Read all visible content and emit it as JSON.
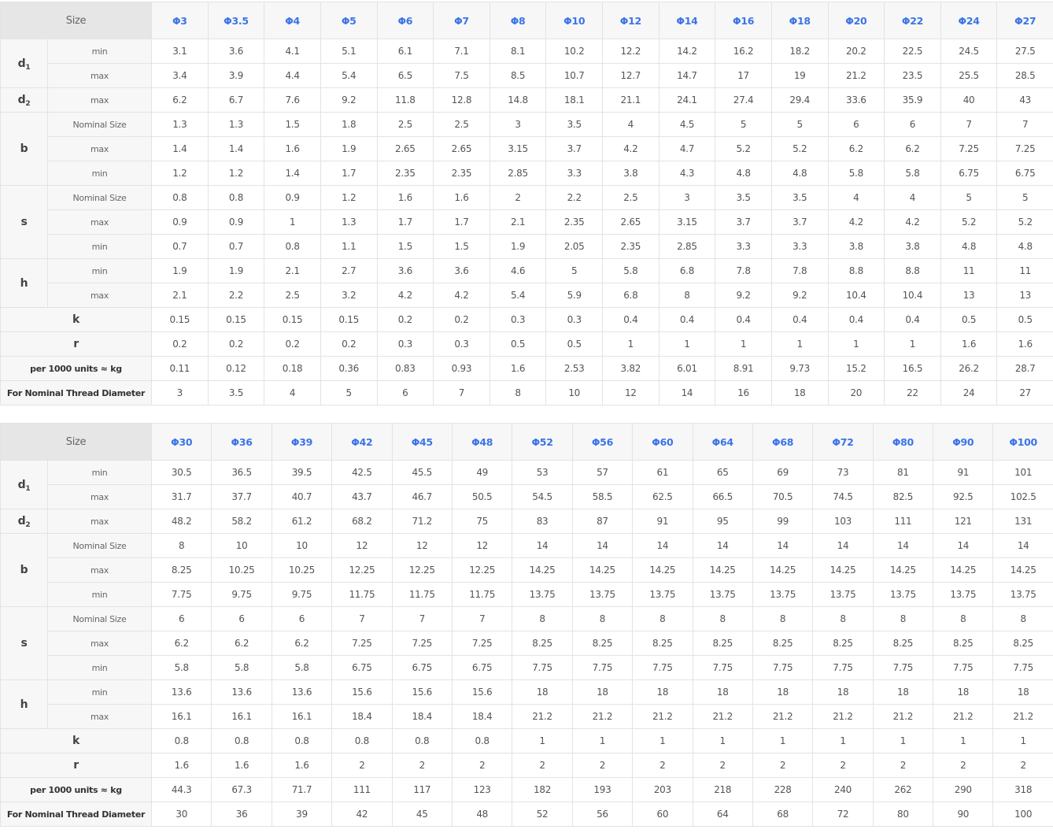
{
  "labels": {
    "size": "Size",
    "d1": "d",
    "d1_sub": "1",
    "d2": "d",
    "d2_sub": "2",
    "b": "b",
    "s": "s",
    "h": "h",
    "k": "k",
    "r": "r",
    "min": "min",
    "max": "max",
    "nominal": "Nominal Size",
    "weight": "per 1000 units ≈ kg",
    "thread": "For Nominal Thread Diameter"
  },
  "tables": [
    {
      "sizes": [
        "Φ3",
        "Φ3.5",
        "Φ4",
        "Φ5",
        "Φ6",
        "Φ7",
        "Φ8",
        "Φ10",
        "Φ12",
        "Φ14",
        "Φ16",
        "Φ18",
        "Φ20",
        "Φ22",
        "Φ24",
        "Φ27"
      ],
      "rows": {
        "d1_min": [
          "3.1",
          "3.6",
          "4.1",
          "5.1",
          "6.1",
          "7.1",
          "8.1",
          "10.2",
          "12.2",
          "14.2",
          "16.2",
          "18.2",
          "20.2",
          "22.5",
          "24.5",
          "27.5"
        ],
        "d1_max": [
          "3.4",
          "3.9",
          "4.4",
          "5.4",
          "6.5",
          "7.5",
          "8.5",
          "10.7",
          "12.7",
          "14.7",
          "17",
          "19",
          "21.2",
          "23.5",
          "25.5",
          "28.5"
        ],
        "d2_max": [
          "6.2",
          "6.7",
          "7.6",
          "9.2",
          "11.8",
          "12.8",
          "14.8",
          "18.1",
          "21.1",
          "24.1",
          "27.4",
          "29.4",
          "33.6",
          "35.9",
          "40",
          "43"
        ],
        "b_nom": [
          "1.3",
          "1.3",
          "1.5",
          "1.8",
          "2.5",
          "2.5",
          "3",
          "3.5",
          "4",
          "4.5",
          "5",
          "5",
          "6",
          "6",
          "7",
          "7"
        ],
        "b_max": [
          "1.4",
          "1.4",
          "1.6",
          "1.9",
          "2.65",
          "2.65",
          "3.15",
          "3.7",
          "4.2",
          "4.7",
          "5.2",
          "5.2",
          "6.2",
          "6.2",
          "7.25",
          "7.25"
        ],
        "b_min": [
          "1.2",
          "1.2",
          "1.4",
          "1.7",
          "2.35",
          "2.35",
          "2.85",
          "3.3",
          "3.8",
          "4.3",
          "4.8",
          "4.8",
          "5.8",
          "5.8",
          "6.75",
          "6.75"
        ],
        "s_nom": [
          "0.8",
          "0.8",
          "0.9",
          "1.2",
          "1.6",
          "1.6",
          "2",
          "2.2",
          "2.5",
          "3",
          "3.5",
          "3.5",
          "4",
          "4",
          "5",
          "5"
        ],
        "s_max": [
          "0.9",
          "0.9",
          "1",
          "1.3",
          "1.7",
          "1.7",
          "2.1",
          "2.35",
          "2.65",
          "3.15",
          "3.7",
          "3.7",
          "4.2",
          "4.2",
          "5.2",
          "5.2"
        ],
        "s_min": [
          "0.7",
          "0.7",
          "0.8",
          "1.1",
          "1.5",
          "1.5",
          "1.9",
          "2.05",
          "2.35",
          "2.85",
          "3.3",
          "3.3",
          "3.8",
          "3.8",
          "4.8",
          "4.8"
        ],
        "h_min": [
          "1.9",
          "1.9",
          "2.1",
          "2.7",
          "3.6",
          "3.6",
          "4.6",
          "5",
          "5.8",
          "6.8",
          "7.8",
          "7.8",
          "8.8",
          "8.8",
          "11",
          "11"
        ],
        "h_max": [
          "2.1",
          "2.2",
          "2.5",
          "3.2",
          "4.2",
          "4.2",
          "5.4",
          "5.9",
          "6.8",
          "8",
          "9.2",
          "9.2",
          "10.4",
          "10.4",
          "13",
          "13"
        ],
        "k": [
          "0.15",
          "0.15",
          "0.15",
          "0.15",
          "0.2",
          "0.2",
          "0.3",
          "0.3",
          "0.4",
          "0.4",
          "0.4",
          "0.4",
          "0.4",
          "0.4",
          "0.5",
          "0.5"
        ],
        "r": [
          "0.2",
          "0.2",
          "0.2",
          "0.2",
          "0.3",
          "0.3",
          "0.5",
          "0.5",
          "1",
          "1",
          "1",
          "1",
          "1",
          "1",
          "1.6",
          "1.6"
        ],
        "weight": [
          "0.11",
          "0.12",
          "0.18",
          "0.36",
          "0.83",
          "0.93",
          "1.6",
          "2.53",
          "3.82",
          "6.01",
          "8.91",
          "9.73",
          "15.2",
          "16.5",
          "26.2",
          "28.7"
        ],
        "thread": [
          "3",
          "3.5",
          "4",
          "5",
          "6",
          "7",
          "8",
          "10",
          "12",
          "14",
          "16",
          "18",
          "20",
          "22",
          "24",
          "27"
        ]
      }
    },
    {
      "sizes": [
        "Φ30",
        "Φ36",
        "Φ39",
        "Φ42",
        "Φ45",
        "Φ48",
        "Φ52",
        "Φ56",
        "Φ60",
        "Φ64",
        "Φ68",
        "Φ72",
        "Φ80",
        "Φ90",
        "Φ100"
      ],
      "rows": {
        "d1_min": [
          "30.5",
          "36.5",
          "39.5",
          "42.5",
          "45.5",
          "49",
          "53",
          "57",
          "61",
          "65",
          "69",
          "73",
          "81",
          "91",
          "101"
        ],
        "d1_max": [
          "31.7",
          "37.7",
          "40.7",
          "43.7",
          "46.7",
          "50.5",
          "54.5",
          "58.5",
          "62.5",
          "66.5",
          "70.5",
          "74.5",
          "82.5",
          "92.5",
          "102.5"
        ],
        "d2_max": [
          "48.2",
          "58.2",
          "61.2",
          "68.2",
          "71.2",
          "75",
          "83",
          "87",
          "91",
          "95",
          "99",
          "103",
          "111",
          "121",
          "131"
        ],
        "b_nom": [
          "8",
          "10",
          "10",
          "12",
          "12",
          "12",
          "14",
          "14",
          "14",
          "14",
          "14",
          "14",
          "14",
          "14",
          "14"
        ],
        "b_max": [
          "8.25",
          "10.25",
          "10.25",
          "12.25",
          "12.25",
          "12.25",
          "14.25",
          "14.25",
          "14.25",
          "14.25",
          "14.25",
          "14.25",
          "14.25",
          "14.25",
          "14.25"
        ],
        "b_min": [
          "7.75",
          "9.75",
          "9.75",
          "11.75",
          "11.75",
          "11.75",
          "13.75",
          "13.75",
          "13.75",
          "13.75",
          "13.75",
          "13.75",
          "13.75",
          "13.75",
          "13.75"
        ],
        "s_nom": [
          "6",
          "6",
          "6",
          "7",
          "7",
          "7",
          "8",
          "8",
          "8",
          "8",
          "8",
          "8",
          "8",
          "8",
          "8"
        ],
        "s_max": [
          "6.2",
          "6.2",
          "6.2",
          "7.25",
          "7.25",
          "7.25",
          "8.25",
          "8.25",
          "8.25",
          "8.25",
          "8.25",
          "8.25",
          "8.25",
          "8.25",
          "8.25"
        ],
        "s_min": [
          "5.8",
          "5.8",
          "5.8",
          "6.75",
          "6.75",
          "6.75",
          "7.75",
          "7.75",
          "7.75",
          "7.75",
          "7.75",
          "7.75",
          "7.75",
          "7.75",
          "7.75"
        ],
        "h_min": [
          "13.6",
          "13.6",
          "13.6",
          "15.6",
          "15.6",
          "15.6",
          "18",
          "18",
          "18",
          "18",
          "18",
          "18",
          "18",
          "18",
          "18"
        ],
        "h_max": [
          "16.1",
          "16.1",
          "16.1",
          "18.4",
          "18.4",
          "18.4",
          "21.2",
          "21.2",
          "21.2",
          "21.2",
          "21.2",
          "21.2",
          "21.2",
          "21.2",
          "21.2"
        ],
        "k": [
          "0.8",
          "0.8",
          "0.8",
          "0.8",
          "0.8",
          "0.8",
          "1",
          "1",
          "1",
          "1",
          "1",
          "1",
          "1",
          "1",
          "1"
        ],
        "r": [
          "1.6",
          "1.6",
          "1.6",
          "2",
          "2",
          "2",
          "2",
          "2",
          "2",
          "2",
          "2",
          "2",
          "2",
          "2",
          "2"
        ],
        "weight": [
          "44.3",
          "67.3",
          "71.7",
          "111",
          "117",
          "123",
          "182",
          "193",
          "203",
          "218",
          "228",
          "240",
          "262",
          "290",
          "318"
        ],
        "thread": [
          "30",
          "36",
          "39",
          "42",
          "45",
          "48",
          "52",
          "56",
          "60",
          "64",
          "68",
          "72",
          "80",
          "90",
          "100"
        ]
      }
    }
  ]
}
